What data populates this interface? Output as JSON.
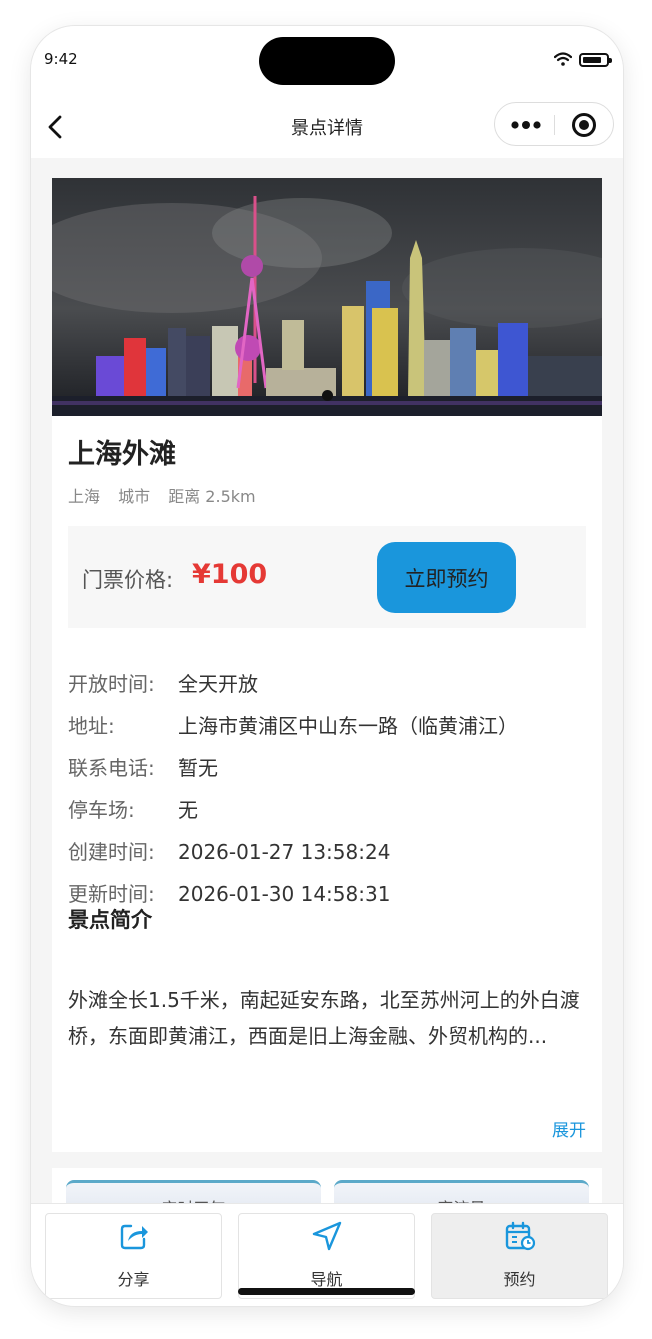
{
  "status_bar": {
    "time": "9:42",
    "battery_level": 0.8
  },
  "nav": {
    "title": "景点详情"
  },
  "spot": {
    "name": "上海外滩",
    "tags": [
      "上海",
      "城市",
      "距离 2.5km"
    ],
    "price_label": "门票价格:",
    "price": "¥100",
    "book_button": "立即预约",
    "info": [
      {
        "label": "开放时间:",
        "value": "全天开放"
      },
      {
        "label": "地址:",
        "value": "上海市黄浦区中山东一路（临黄浦江）"
      },
      {
        "label": "联系电话:",
        "value": "暂无"
      },
      {
        "label": "停车场:",
        "value": "无"
      },
      {
        "label": "创建时间:",
        "value": "2026-01-27 13:58:24"
      },
      {
        "label": "更新时间:",
        "value": "2026-01-30 14:58:31"
      }
    ],
    "intro_title": "景点简介",
    "intro_text": "外滩全长1.5千米，南起延安东路，北至苏州河上的外白渡桥，东面即黄浦江，西面是旧上海金融、外贸机构的...",
    "expand_label": "展开"
  },
  "next_section": {
    "weather_tab": "实时天气",
    "flow_tab": "客流量"
  },
  "tabbar": {
    "items": [
      {
        "label": "分享",
        "icon": "share-icon"
      },
      {
        "label": "导航",
        "icon": "navigation-icon"
      },
      {
        "label": "预约",
        "icon": "calendar-icon"
      }
    ]
  },
  "colors": {
    "accent": "#1a96dc",
    "price": "#e53935"
  }
}
